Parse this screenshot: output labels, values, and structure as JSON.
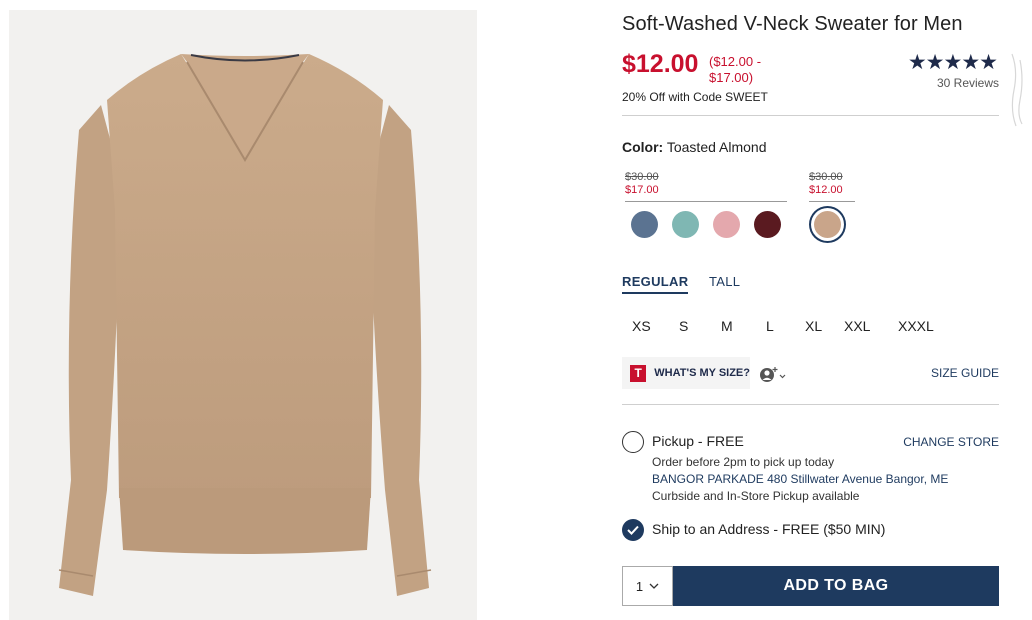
{
  "product": {
    "title": "Soft-Washed V-Neck Sweater for Men",
    "price": "$12.00",
    "price_range": "($12.00 - $17.00)",
    "promo": "20% Off with Code SWEET",
    "rating_stars": "★★★★★",
    "rating": 4.5,
    "reviews": "30 Reviews"
  },
  "color": {
    "label": "Color:",
    "value": "Toasted Almond",
    "price_groups": [
      {
        "old": "$30.00",
        "new": "$17.00"
      },
      {
        "old": "$30.00",
        "new": "$12.00"
      }
    ],
    "swatches": [
      {
        "name": "blue",
        "hex": "#5b7391"
      },
      {
        "name": "teal",
        "hex": "#7fb7b3"
      },
      {
        "name": "pink",
        "hex": "#e4a8ad"
      },
      {
        "name": "burgundy",
        "hex": "#5a1a20"
      },
      {
        "name": "toasted-almond",
        "hex": "#c9a58a",
        "selected": true
      }
    ]
  },
  "fit_tabs": {
    "regular": "REGULAR",
    "tall": "TALL"
  },
  "sizes": [
    "XS",
    "S",
    "M",
    "L",
    "XL",
    "XXL",
    "XXXL"
  ],
  "size_tools": {
    "logo": "T",
    "whats_my_size": "WHAT'S MY SIZE?",
    "size_guide": "SIZE GUIDE"
  },
  "fulfillment": {
    "pickup_label": "Pickup - FREE",
    "change_store": "CHANGE STORE",
    "pickup_note": "Order before 2pm to pick up today",
    "store": "BANGOR PARKADE 480 Stillwater Avenue  Bangor, ME",
    "pickup_extra": "Curbside and In-Store Pickup available",
    "ship_label": "Ship to an Address - FREE ($50 MIN)"
  },
  "cart": {
    "quantity": "1",
    "add_label": "ADD TO BAG"
  },
  "colors": {
    "brand_navy": "#1e3a5f",
    "sale_red": "#c8102e",
    "sweater": "#c4a585"
  }
}
